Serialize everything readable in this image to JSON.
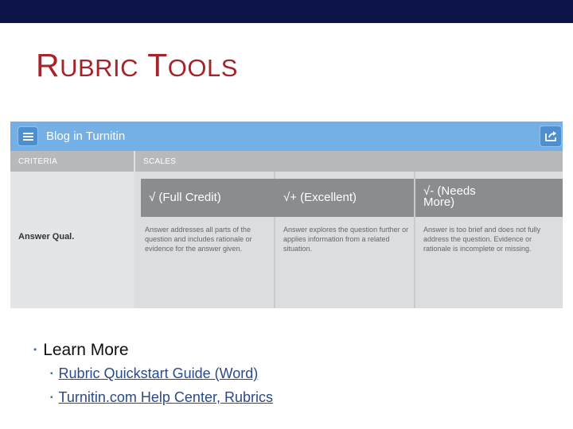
{
  "slide": {
    "title_first_cap": "R",
    "title_first_rest": "UBRIC",
    "title_second_cap": "T",
    "title_second_rest": "OOLS"
  },
  "screenshot": {
    "app_title": "Blog in Turnitin",
    "criteria_header": "CRITERIA",
    "scales_header": "SCALES",
    "criterion": "Answer Qual.",
    "scales": [
      {
        "label": "√ (Full Credit)",
        "description": "Answer addresses all parts of the question and includes rationale or evidence for the answer given."
      },
      {
        "label": "√+ (Excellent)",
        "description": "Answer explores the question further or applies information from a related situation."
      },
      {
        "label": "√- (Needs More)",
        "description": "Answer is too brief and does not fully address the question. Evidence or rationale is incomplete or missing."
      }
    ],
    "icons": [
      "list-menu-icon",
      "share-icon"
    ]
  },
  "bullets": {
    "main": "Learn More",
    "links": [
      "Rubric Quickstart Guide (Word)",
      "Turnitin.com Help Center, Rubrics"
    ]
  },
  "colors": {
    "top_bar": "#0c1447",
    "title": "#a5232b",
    "app_header": "#74b0e6",
    "scale_header": "#8a8c90",
    "link": "#2b4a8c"
  }
}
